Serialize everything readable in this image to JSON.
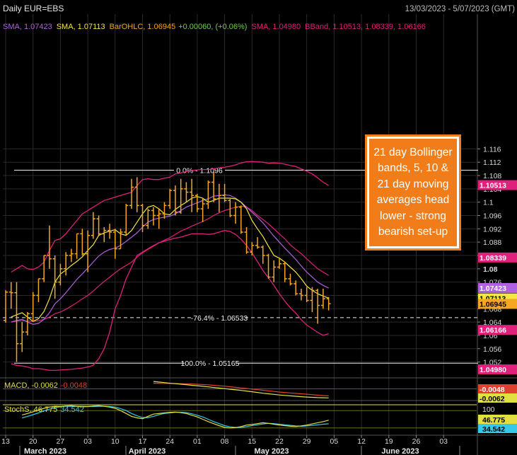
{
  "header": {
    "title": "Daily EUR=EBS",
    "date_range": "13/03/2023 - 5/07/2023 (GMT)"
  },
  "colors": {
    "background": "#000000",
    "grid": "#2a2a2a",
    "ohlc": "#f5a623",
    "sma5": "#f5e642",
    "sma10": "#b060e0",
    "sma21": "#e0207a",
    "bband": "#e0207a",
    "macd": "#e0e040",
    "macd_signal": "#e04030",
    "stoch_k": "#e0e040",
    "stoch_d": "#35c8e8",
    "callout_fill": "#f07d1a"
  },
  "legend": {
    "sma1_name": "SMA, ",
    "sma1_value": "1.07423",
    "sma2_name": "SMA, ",
    "sma2_value": "1.07113",
    "ohlc_name": "BarOHLC, ",
    "ohlc_value": "1.06945",
    "ohlc_change": "+0.00060, (+0.06%)",
    "sma3_name": "SMA, ",
    "sma3_value": "1.04980",
    "bband_name": "BBand, ",
    "bband_values": "1.10513, 1.08339, 1.06166"
  },
  "macd_legend": {
    "name": "MACD, ",
    "value1": "-0.0062",
    "value2": "-0.0048"
  },
  "stoch_legend": {
    "name": "StochS, ",
    "value1": "46.775",
    "value2": "34.542"
  },
  "price_axis_tags": [
    {
      "text": "1.10513",
      "value": 1.10513,
      "bg": "#e0207a",
      "fg": "#ffffff"
    },
    {
      "text": "1.08339",
      "value": 1.08339,
      "bg": "#e0207a",
      "fg": "#ffffff"
    },
    {
      "text": "1.07423",
      "value": 1.07423,
      "bg": "#b060e0",
      "fg": "#ffffff"
    },
    {
      "text": "1.07113",
      "value": 1.07113,
      "bg": "#f5e642",
      "fg": "#000000"
    },
    {
      "text": "1.06945",
      "value": 1.06945,
      "bg": "#f5a623",
      "fg": "#000000"
    },
    {
      "text": "1.06166",
      "value": 1.06166,
      "bg": "#e0207a",
      "fg": "#ffffff"
    },
    {
      "text": "1.04980",
      "value": 1.0498,
      "bg": "#e0207a",
      "fg": "#ffffff"
    }
  ],
  "macd_tags": [
    {
      "text": "-0.0048",
      "bg": "#e04030",
      "fg": "#ffffff"
    },
    {
      "text": "-0.0062",
      "bg": "#e0e040",
      "fg": "#000000"
    }
  ],
  "stoch_tags": [
    {
      "text": "100",
      "bg": "",
      "fg": "#dddddd"
    },
    {
      "text": "46.775",
      "bg": "#e0e040",
      "fg": "#000000"
    },
    {
      "text": "34.542",
      "bg": "#35c8e8",
      "fg": "#000000"
    }
  ],
  "fib_levels": [
    {
      "label": "0.0% - 1.1096",
      "value": 1.1096
    },
    {
      "label": "-76.4% - 1.06533",
      "value": 1.06533
    },
    {
      "label": "100.0% - 1.05165",
      "value": 1.05165
    }
  ],
  "callout_text": "21 day Bollinger bands, 5, 10 & 21 day moving averages head lower - strong bearish set-up",
  "chart_data": {
    "type": "ohlc",
    "y_range": [
      1.0495,
      1.1175
    ],
    "y_ticks": [
      "1.116",
      "1.112",
      "1.108",
      "1.104",
      "1.1",
      "1.096",
      "1.092",
      "1.088",
      "1.084",
      "1.08",
      "1.076",
      "1.072",
      "1.068",
      "1.064",
      "1.06",
      "1.056",
      "1.052"
    ],
    "x_ticks": [
      "13",
      "20",
      "27",
      "03",
      "10",
      "17",
      "24",
      "01",
      "08",
      "15",
      "22",
      "29",
      "05",
      "12",
      "19",
      "26",
      "03"
    ],
    "month_labels": [
      "March 2023",
      "April 2023",
      "May 2023",
      "June 2023"
    ],
    "bars": [
      {
        "date": "2023-03-13",
        "o": 1.0645,
        "h": 1.0736,
        "l": 1.0638,
        "c": 1.073
      },
      {
        "date": "2023-03-14",
        "o": 1.073,
        "h": 1.076,
        "l": 1.068,
        "c": 1.0728
      },
      {
        "date": "2023-03-15",
        "o": 1.0728,
        "h": 1.076,
        "l": 1.052,
        "c": 1.0575
      },
      {
        "date": "2023-03-16",
        "o": 1.0575,
        "h": 1.064,
        "l": 1.055,
        "c": 1.061
      },
      {
        "date": "2023-03-17",
        "o": 1.061,
        "h": 1.067,
        "l": 1.06,
        "c": 1.0665
      },
      {
        "date": "2023-03-20",
        "o": 1.0665,
        "h": 1.073,
        "l": 1.0645,
        "c": 1.072
      },
      {
        "date": "2023-03-21",
        "o": 1.072,
        "h": 1.077,
        "l": 1.07,
        "c": 1.077
      },
      {
        "date": "2023-03-22",
        "o": 1.077,
        "h": 1.084,
        "l": 1.076,
        "c": 1.084
      },
      {
        "date": "2023-03-23",
        "o": 1.084,
        "h": 1.093,
        "l": 1.08,
        "c": 1.083
      },
      {
        "date": "2023-03-24",
        "o": 1.083,
        "h": 1.084,
        "l": 1.071,
        "c": 1.076
      },
      {
        "date": "2023-03-27",
        "o": 1.076,
        "h": 1.0815,
        "l": 1.075,
        "c": 1.08
      },
      {
        "date": "2023-03-28",
        "o": 1.08,
        "h": 1.085,
        "l": 1.078,
        "c": 1.084
      },
      {
        "date": "2023-03-29",
        "o": 1.084,
        "h": 1.086,
        "l": 1.082,
        "c": 1.0845
      },
      {
        "date": "2023-03-30",
        "o": 1.0845,
        "h": 1.0905,
        "l": 1.083,
        "c": 1.0905
      },
      {
        "date": "2023-03-31",
        "o": 1.0905,
        "h": 1.092,
        "l": 1.084,
        "c": 1.0845
      },
      {
        "date": "2023-04-03",
        "o": 1.0845,
        "h": 1.0915,
        "l": 1.079,
        "c": 1.09
      },
      {
        "date": "2023-04-04",
        "o": 1.09,
        "h": 1.097,
        "l": 1.089,
        "c": 1.095
      },
      {
        "date": "2023-04-05",
        "o": 1.095,
        "h": 1.096,
        "l": 1.09,
        "c": 1.0905
      },
      {
        "date": "2023-04-06",
        "o": 1.0905,
        "h": 1.0925,
        "l": 1.088,
        "c": 1.0915
      },
      {
        "date": "2023-04-07",
        "o": 1.0915,
        "h": 1.0935,
        "l": 1.089,
        "c": 1.091
      },
      {
        "date": "2023-04-10",
        "o": 1.091,
        "h": 1.092,
        "l": 1.083,
        "c": 1.086
      },
      {
        "date": "2023-04-11",
        "o": 1.086,
        "h": 1.092,
        "l": 1.086,
        "c": 1.091
      },
      {
        "date": "2023-04-12",
        "o": 1.091,
        "h": 1.0995,
        "l": 1.09,
        "c": 1.099
      },
      {
        "date": "2023-04-13",
        "o": 1.099,
        "h": 1.107,
        "l": 1.098,
        "c": 1.1045
      },
      {
        "date": "2023-04-14",
        "o": 1.1045,
        "h": 1.1075,
        "l": 1.097,
        "c": 1.099
      },
      {
        "date": "2023-04-17",
        "o": 1.099,
        "h": 1.0995,
        "l": 1.091,
        "c": 1.093
      },
      {
        "date": "2023-04-18",
        "o": 1.093,
        "h": 1.098,
        "l": 1.092,
        "c": 1.0975
      },
      {
        "date": "2023-04-19",
        "o": 1.0975,
        "h": 1.0985,
        "l": 1.093,
        "c": 1.096
      },
      {
        "date": "2023-04-20",
        "o": 1.096,
        "h": 1.098,
        "l": 1.092,
        "c": 1.0965
      },
      {
        "date": "2023-04-21",
        "o": 1.0965,
        "h": 1.1,
        "l": 1.095,
        "c": 1.099
      },
      {
        "date": "2023-04-24",
        "o": 1.099,
        "h": 1.104,
        "l": 1.098,
        "c": 1.1035
      },
      {
        "date": "2023-04-25",
        "o": 1.1035,
        "h": 1.105,
        "l": 1.096,
        "c": 1.097
      },
      {
        "date": "2023-04-26",
        "o": 1.097,
        "h": 1.107,
        "l": 1.0965,
        "c": 1.104
      },
      {
        "date": "2023-04-27",
        "o": 1.104,
        "h": 1.106,
        "l": 1.1,
        "c": 1.103
      },
      {
        "date": "2023-04-28",
        "o": 1.103,
        "h": 1.107,
        "l": 1.097,
        "c": 1.102
      },
      {
        "date": "2023-05-01",
        "o": 1.102,
        "h": 1.1025,
        "l": 1.097,
        "c": 1.098
      },
      {
        "date": "2023-05-02",
        "o": 1.098,
        "h": 1.101,
        "l": 1.094,
        "c": 1.0995
      },
      {
        "date": "2023-05-03",
        "o": 1.0995,
        "h": 1.1065,
        "l": 1.098,
        "c": 1.106
      },
      {
        "date": "2023-05-04",
        "o": 1.106,
        "h": 1.1092,
        "l": 1.1,
        "c": 1.101
      },
      {
        "date": "2023-05-05",
        "o": 1.101,
        "h": 1.1055,
        "l": 1.097,
        "c": 1.102
      },
      {
        "date": "2023-05-08",
        "o": 1.102,
        "h": 1.1055,
        "l": 1.1,
        "c": 1.1005
      },
      {
        "date": "2023-05-09",
        "o": 1.1005,
        "h": 1.101,
        "l": 1.0955,
        "c": 1.096
      },
      {
        "date": "2023-05-10",
        "o": 1.096,
        "h": 1.1,
        "l": 1.0935,
        "c": 1.0985
      },
      {
        "date": "2023-05-11",
        "o": 1.0985,
        "h": 1.099,
        "l": 1.0905,
        "c": 1.091
      },
      {
        "date": "2023-05-12",
        "o": 1.091,
        "h": 1.0925,
        "l": 1.0845,
        "c": 1.085
      },
      {
        "date": "2023-05-15",
        "o": 1.085,
        "h": 1.088,
        "l": 1.084,
        "c": 1.087
      },
      {
        "date": "2023-05-16",
        "o": 1.087,
        "h": 1.0895,
        "l": 1.086,
        "c": 1.0865
      },
      {
        "date": "2023-05-17",
        "o": 1.0865,
        "h": 1.087,
        "l": 1.0815,
        "c": 1.084
      },
      {
        "date": "2023-05-18",
        "o": 1.084,
        "h": 1.0845,
        "l": 1.077,
        "c": 1.0775
      },
      {
        "date": "2023-05-19",
        "o": 1.0775,
        "h": 1.0825,
        "l": 1.076,
        "c": 1.0805
      },
      {
        "date": "2023-05-22",
        "o": 1.0805,
        "h": 1.083,
        "l": 1.08,
        "c": 1.0815
      },
      {
        "date": "2023-05-23",
        "o": 1.0815,
        "h": 1.082,
        "l": 1.076,
        "c": 1.077
      },
      {
        "date": "2023-05-24",
        "o": 1.077,
        "h": 1.0785,
        "l": 1.075,
        "c": 1.0755
      },
      {
        "date": "2023-05-25",
        "o": 1.0755,
        "h": 1.0765,
        "l": 1.072,
        "c": 1.0725
      },
      {
        "date": "2023-05-26",
        "o": 1.0725,
        "h": 1.074,
        "l": 1.0705,
        "c": 1.072
      },
      {
        "date": "2023-05-29",
        "o": 1.072,
        "h": 1.0745,
        "l": 1.07,
        "c": 1.0705
      },
      {
        "date": "2023-05-30",
        "o": 1.0705,
        "h": 1.0745,
        "l": 1.067,
        "c": 1.0735
      },
      {
        "date": "2023-05-31",
        "o": 1.0735,
        "h": 1.074,
        "l": 1.0635,
        "c": 1.069
      },
      {
        "date": "2023-06-01",
        "o": 1.069,
        "h": 1.074,
        "l": 1.068,
        "c": 1.071
      },
      {
        "date": "2023-06-02",
        "o": 1.071,
        "h": 1.0715,
        "l": 1.0675,
        "c": 1.0695
      }
    ],
    "bb_upper": [
      1.079,
      1.08,
      1.081,
      1.08,
      1.0798,
      1.0805,
      1.082,
      1.0855,
      1.0885,
      1.089,
      1.0905,
      1.0925,
      1.0945,
      1.0965,
      1.0975,
      1.0985,
      1.0995,
      1.1005,
      1.101,
      1.1015,
      1.102,
      1.1025,
      1.103,
      1.105,
      1.1068,
      1.107,
      1.1068,
      1.1068,
      1.1072,
      1.1075,
      1.1085,
      1.1088,
      1.1092,
      1.1095,
      1.1097,
      1.1098,
      1.1098,
      1.11,
      1.1103,
      1.1105,
      1.1108,
      1.1112,
      1.1118,
      1.1121,
      1.1122,
      1.1121,
      1.112,
      1.1117,
      1.1118,
      1.1117,
      1.1114,
      1.111,
      1.1107,
      1.11,
      1.1093,
      1.1085,
      1.1073,
      1.106,
      1.105
    ],
    "bb_lower": [
      1.0515,
      1.051,
      1.0508,
      1.0505,
      1.05,
      1.05,
      1.0498,
      1.0495,
      1.0495,
      1.0496,
      1.0497,
      1.0498,
      1.05,
      1.0502,
      1.0505,
      1.051,
      1.053,
      1.056,
      1.061,
      1.068,
      1.072,
      1.077,
      1.0805,
      1.084,
      1.085,
      1.086,
      1.087,
      1.0878,
      1.0883,
      1.0888,
      1.0892,
      1.0895,
      1.09,
      1.0905,
      1.0905,
      1.0905,
      1.0903,
      1.0905,
      1.091,
      1.0915,
      1.0912,
      1.0903,
      1.0889,
      1.087,
      1.0848,
      1.0822,
      1.0795,
      1.0773,
      1.075,
      1.0725,
      1.0703,
      1.0683,
      1.0667,
      1.0647,
      1.0631,
      1.062,
      1.0609,
      1.06,
      1.0605
    ],
    "sma5": [
      1.0655,
      1.0662,
      1.0668,
      1.0655,
      1.0642,
      1.065,
      1.0672,
      1.071,
      1.076,
      1.0784,
      1.0796,
      1.081,
      1.0822,
      1.0836,
      1.0855,
      1.0872,
      1.09,
      1.0908,
      1.0913,
      1.0917,
      1.0905,
      1.09,
      1.0915,
      1.094,
      1.0965,
      1.0985,
      1.099,
      1.098,
      1.0965,
      1.0962,
      1.0978,
      1.099,
      1.1,
      1.1012,
      1.1017,
      1.1012,
      1.1,
      1.1005,
      1.1012,
      1.1012,
      1.1012,
      1.101,
      1.1,
      1.098,
      1.0945,
      1.092,
      1.0897,
      1.0868,
      1.084,
      1.0832,
      1.082,
      1.0805,
      1.079,
      1.077,
      1.0748,
      1.0735,
      1.0725,
      1.0718,
      1.0712
    ],
    "sma10": [
      1.064,
      1.0645,
      1.0648,
      1.064,
      1.0633,
      1.0636,
      1.0648,
      1.0668,
      1.0695,
      1.071,
      1.0728,
      1.0748,
      1.0768,
      1.0785,
      1.0802,
      1.082,
      1.0838,
      1.085,
      1.0858,
      1.0862,
      1.087,
      1.0882,
      1.0895,
      1.0908,
      1.0925,
      1.094,
      1.0948,
      1.0952,
      1.0955,
      1.0958,
      1.0965,
      1.0975,
      1.0985,
      1.0992,
      1.0998,
      1.1005,
      1.101,
      1.1018,
      1.102,
      1.1022,
      1.102,
      1.1012,
      1.1,
      1.0985,
      1.097,
      1.0955,
      1.0938,
      1.0918,
      1.0898,
      1.088,
      1.0862,
      1.0845,
      1.0828,
      1.0808,
      1.079,
      1.0775,
      1.076,
      1.075,
      1.0742
    ],
    "sma21": [
      1.064,
      1.0643,
      1.0644,
      1.0643,
      1.0642,
      1.0644,
      1.0648,
      1.0655,
      1.0665,
      1.067,
      1.0678,
      1.0688,
      1.0698,
      1.071,
      1.072,
      1.0733,
      1.0748,
      1.0762,
      1.0775,
      1.0788,
      1.08,
      1.081,
      1.082,
      1.0835,
      1.0848,
      1.0858,
      1.0868,
      1.0878,
      1.0886,
      1.0893,
      1.0903,
      1.0913,
      1.092,
      1.0928,
      1.0935,
      1.0942,
      1.095,
      1.096,
      1.0968,
      1.0975,
      1.098,
      1.0985,
      1.0988,
      1.0985,
      1.0975,
      1.096,
      1.0948,
      1.0935,
      1.092,
      1.0905,
      1.089,
      1.0872,
      1.0858,
      1.0845,
      1.083,
      1.0815,
      1.08,
      1.079,
      1.078
    ],
    "macd": [
      0.005,
      0.0046,
      0.0042,
      0.0038,
      0.0035,
      0.0031,
      0.0028,
      0.0024,
      0.0021,
      0.0017,
      0.0013,
      0.0009,
      0.0005,
      0.0001,
      -0.0003,
      -0.0007,
      -0.0011,
      -0.0015,
      -0.002,
      -0.0025,
      -0.003,
      -0.0034,
      -0.0038,
      -0.0042,
      -0.0045,
      -0.0048,
      -0.0051,
      -0.0054,
      -0.0056,
      -0.0058,
      -0.006,
      -0.0061,
      -0.0062
    ],
    "macd_signal": [
      0.0038,
      0.0038,
      0.0037,
      0.0037,
      0.0036,
      0.0035,
      0.0034,
      0.0033,
      0.0031,
      0.0029,
      0.0027,
      0.0024,
      0.0021,
      0.0018,
      0.0014,
      0.001,
      0.0006,
      0.0002,
      -0.0002,
      -0.0006,
      -0.001,
      -0.0014,
      -0.0018,
      -0.0022,
      -0.0025,
      -0.0028,
      -0.0031,
      -0.0034,
      -0.0037,
      -0.004,
      -0.0043,
      -0.0046,
      -0.0048
    ],
    "stoch_k": [
      65,
      70,
      76,
      82,
      88,
      92,
      95,
      94,
      96,
      97,
      95,
      93,
      94,
      96,
      97,
      95,
      92,
      88,
      80,
      70,
      60,
      55,
      52,
      60,
      68,
      70,
      72,
      74,
      75,
      73,
      70,
      64,
      58,
      50,
      42,
      35,
      28,
      22,
      20,
      21,
      25,
      30,
      32,
      35,
      38,
      36,
      33,
      30,
      28,
      26,
      25,
      27,
      30,
      34,
      38,
      42,
      46.775
    ],
    "stoch_d": [
      55,
      60,
      66,
      72,
      79,
      85,
      90,
      93,
      95,
      95,
      95,
      95,
      94,
      94,
      95,
      95,
      94,
      92,
      87,
      80,
      70,
      62,
      56,
      56,
      60,
      66,
      70,
      72,
      74,
      74,
      73,
      69,
      64,
      58,
      50,
      42,
      35,
      28,
      24,
      22,
      22,
      25,
      28,
      31,
      34,
      36,
      35,
      33,
      31,
      29,
      27,
      26,
      27,
      29,
      31,
      33,
      34.542
    ],
    "stoch_levels": [
      20,
      80,
      100
    ]
  }
}
